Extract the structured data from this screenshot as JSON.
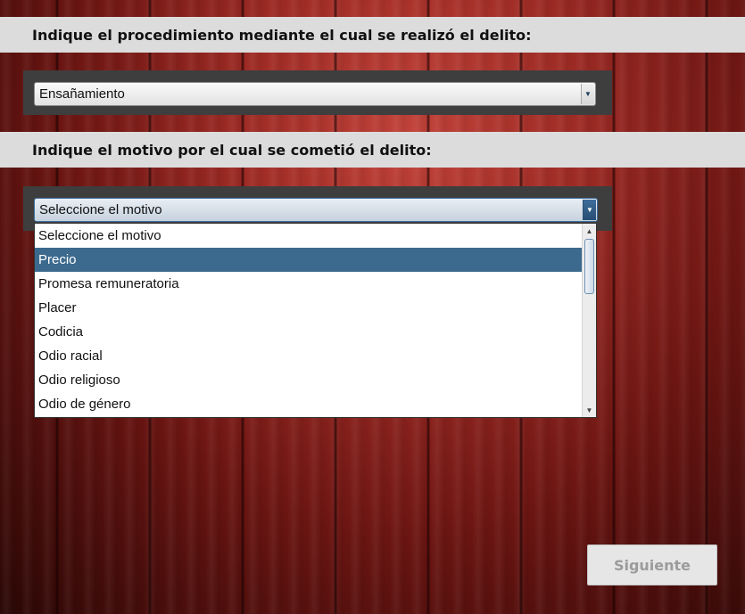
{
  "question1": {
    "label": "Indique el procedimiento mediante el cual se realizó el delito:",
    "selected_value": "Ensañamiento"
  },
  "question2": {
    "label": "Indique el motivo por el cual se cometió el delito:",
    "selected_value": "Seleccione el motivo",
    "dropdown_open": true,
    "highlighted_option": "Precio",
    "options": [
      "Seleccione el motivo",
      "Precio",
      "Promesa remuneratoria",
      "Placer",
      "Codicia",
      "Odio racial",
      "Odio religioso",
      "Odio de género"
    ]
  },
  "next_button": {
    "label": "Siguiente",
    "enabled": false
  },
  "icons": {
    "combo_arrow": "chevron-down-icon",
    "scroll_up": "scroll-up-icon",
    "scroll_down": "scroll-down-icon"
  },
  "colors": {
    "header_bg": "#dcdcdc",
    "panel_bg": "#3e3e3e",
    "highlight": "#3c6a8e",
    "background_wood": "#9d2a24"
  }
}
